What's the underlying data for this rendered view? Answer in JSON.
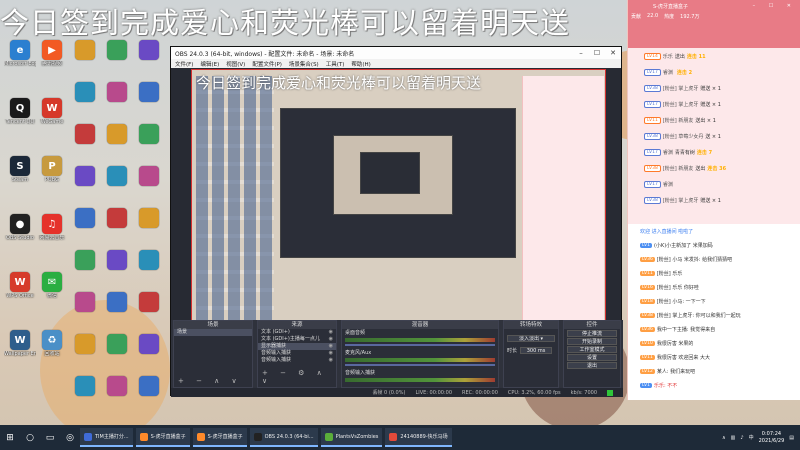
{
  "overlay_banner": "今日签到完成爱心和荧光棒可以留着明天送",
  "desktop_icons": [
    {
      "label": "Microsoft Edge",
      "icon": "edge-icon",
      "color": "#2b7fd0",
      "glyph": "e"
    },
    {
      "label": "腾讯视频",
      "icon": "video-icon",
      "color": "#f25a24",
      "glyph": "▶"
    },
    {
      "label": "Tencent QQ",
      "icon": "qq-icon",
      "color": "#1a1a1a",
      "glyph": "Q"
    },
    {
      "label": "WeGame",
      "icon": "wegame-icon",
      "color": "#d6382a",
      "glyph": "W"
    },
    {
      "label": "Steam",
      "icon": "steam-icon",
      "color": "#1b2838",
      "glyph": "S"
    },
    {
      "label": "PUBG",
      "icon": "pubg-icon",
      "color": "#c79a3e",
      "glyph": "P"
    },
    {
      "label": "OBS Studio",
      "icon": "obs-icon",
      "color": "#222",
      "glyph": "●"
    },
    {
      "label": "网易云音乐",
      "icon": "music-icon",
      "color": "#e5322b",
      "glyph": "♫"
    },
    {
      "label": "WPS Office",
      "icon": "wps-icon",
      "color": "#d63b2b",
      "glyph": "W"
    },
    {
      "label": "微信",
      "icon": "wechat-icon",
      "color": "#2aae41",
      "glyph": "✉"
    },
    {
      "label": "Wallpaper Engine",
      "icon": "wallpaper-icon",
      "color": "#2e5e8c",
      "glyph": "W"
    },
    {
      "label": "回收站",
      "icon": "recycle-bin-icon",
      "color": "#4a8fc7",
      "glyph": "♻"
    }
  ],
  "obs": {
    "title": "OBS 24.0.3 (64-bit, windows) - 配置文件: 未命名 - 场景: 未命名",
    "menu": [
      "文件(F)",
      "编辑(E)",
      "视图(V)",
      "配置文件(P)",
      "场景集合(S)",
      "工具(T)",
      "帮助(H)"
    ],
    "docks": {
      "scenes": {
        "title": "场景",
        "items": [
          "场景"
        ]
      },
      "sources": {
        "title": "来源",
        "items": [
          "文本 (GDI+)",
          "文本 (GDI+)主播每一点儿",
          "显示器捕获",
          "音频输入捕获",
          "音频输入捕获"
        ]
      },
      "mixer": {
        "title": "混音器",
        "channels": [
          "桌面音频",
          "麦克风/Aux",
          "音频输入捕获"
        ]
      },
      "transitions": {
        "title": "转场特效",
        "duration_label": "时长",
        "duration": "300 ms"
      },
      "controls": {
        "title": "控件",
        "buttons": [
          "停止推流",
          "开始录制",
          "工作室模式",
          "设置",
          "退出"
        ]
      }
    },
    "status": {
      "drop": "丢帧 0 (0.0%)",
      "live": "LIVE: 00:00:00",
      "rec": "REC: 00:00:00",
      "cpu": "CPU: 3.2%, 60.00 fps",
      "bitrate": "kb/s: 7000"
    }
  },
  "chat": {
    "header_title": "S-虎牙直播盒子",
    "stats": [
      "贡献",
      "22.0",
      "热度",
      "192.7万"
    ],
    "rows": [
      {
        "lv": "LV14",
        "name": "乐乐",
        "msg": "送出",
        "gift": "连击 11",
        "lvc": "orange"
      },
      {
        "lv": "LV17",
        "name": "睿渊",
        "msg": "",
        "gift": "连击 2",
        "lvc": "blue"
      },
      {
        "lv": "LV38",
        "name": "[粉丝] 掌上虎牙",
        "msg": "赠送 × 1",
        "gift": "",
        "lvc": "blue"
      },
      {
        "lv": "LV17",
        "name": "[粉丝] 掌上虎牙",
        "msg": "赠送 × 1",
        "gift": "",
        "lvc": "blue"
      },
      {
        "lv": "LV11",
        "name": "[粉丝] 新朋友",
        "msg": "送出 × 1",
        "gift": "",
        "lvc": "orange"
      },
      {
        "lv": "LV38",
        "name": "[粉丝] 草莓少女丹",
        "msg": "送 × 1",
        "gift": "",
        "lvc": "blue"
      },
      {
        "lv": "LV17",
        "name": "睿渊",
        "msg": "青青有树",
        "gift": "连击 7",
        "lvc": "blue"
      },
      {
        "lv": "LV38",
        "name": "[粉丝] 新朋友",
        "msg": "送出",
        "gift": "连击 36",
        "lvc": "orange"
      },
      {
        "lv": "LV17",
        "name": "睿渊",
        "msg": "",
        "gift": "",
        "lvc": "blue"
      },
      {
        "lv": "LV38",
        "name": "[粉丝] 掌上虎牙",
        "msg": "赠送 × 1",
        "gift": "",
        "lvc": "blue"
      }
    ],
    "messages": [
      {
        "tag": "",
        "text": "欢迎 进入直播间 啦啦了",
        "color": "blue"
      },
      {
        "tag": "LV1",
        "text": "(小K)小主新加了 米果加码",
        "color": ""
      },
      {
        "tag": "LV36",
        "text": "[粉丝] 小马 米发抖: 给我们猜猜吧",
        "color": ""
      },
      {
        "tag": "LV11",
        "text": "[粉丝] 乐乐",
        "color": ""
      },
      {
        "tag": "LV16",
        "text": "[粉丝] 乐乐 你好哇",
        "color": ""
      },
      {
        "tag": "LV18",
        "text": "[粉丝] 小马: 一下一下",
        "color": ""
      },
      {
        "tag": "LV38",
        "text": "[粉丝] 掌上虎牙: 你可以和我们一起玩",
        "color": ""
      },
      {
        "tag": "LV36",
        "text": "我中一下主播: 我觉得来自",
        "color": ""
      },
      {
        "tag": "LV10",
        "text": "我很厉害 米果的",
        "color": ""
      },
      {
        "tag": "LV11",
        "text": "我很厉害 欢迎回来 大大",
        "color": ""
      },
      {
        "tag": "LV12",
        "text": "某人: 我们来玩吧",
        "color": ""
      },
      {
        "tag": "LV1",
        "text": "乐乐: 不不",
        "color": "red"
      }
    ]
  },
  "taskbar": {
    "tasks": [
      {
        "label": "TIM主播打分...",
        "color": "#3f6bd8"
      },
      {
        "label": "S-虎牙直播盒子",
        "color": "#ff8a2a"
      },
      {
        "label": "S-虎牙直播盒子",
        "color": "#ff8a2a"
      },
      {
        "label": "OBS 24.0.3 (64-bi...",
        "color": "#222"
      },
      {
        "label": "PlantsVsZombies",
        "color": "#5aae3a"
      },
      {
        "label": "24140889-快乐马场",
        "color": "#e34a3a"
      }
    ],
    "time": "0:07:24",
    "date": "2021/6/29"
  }
}
